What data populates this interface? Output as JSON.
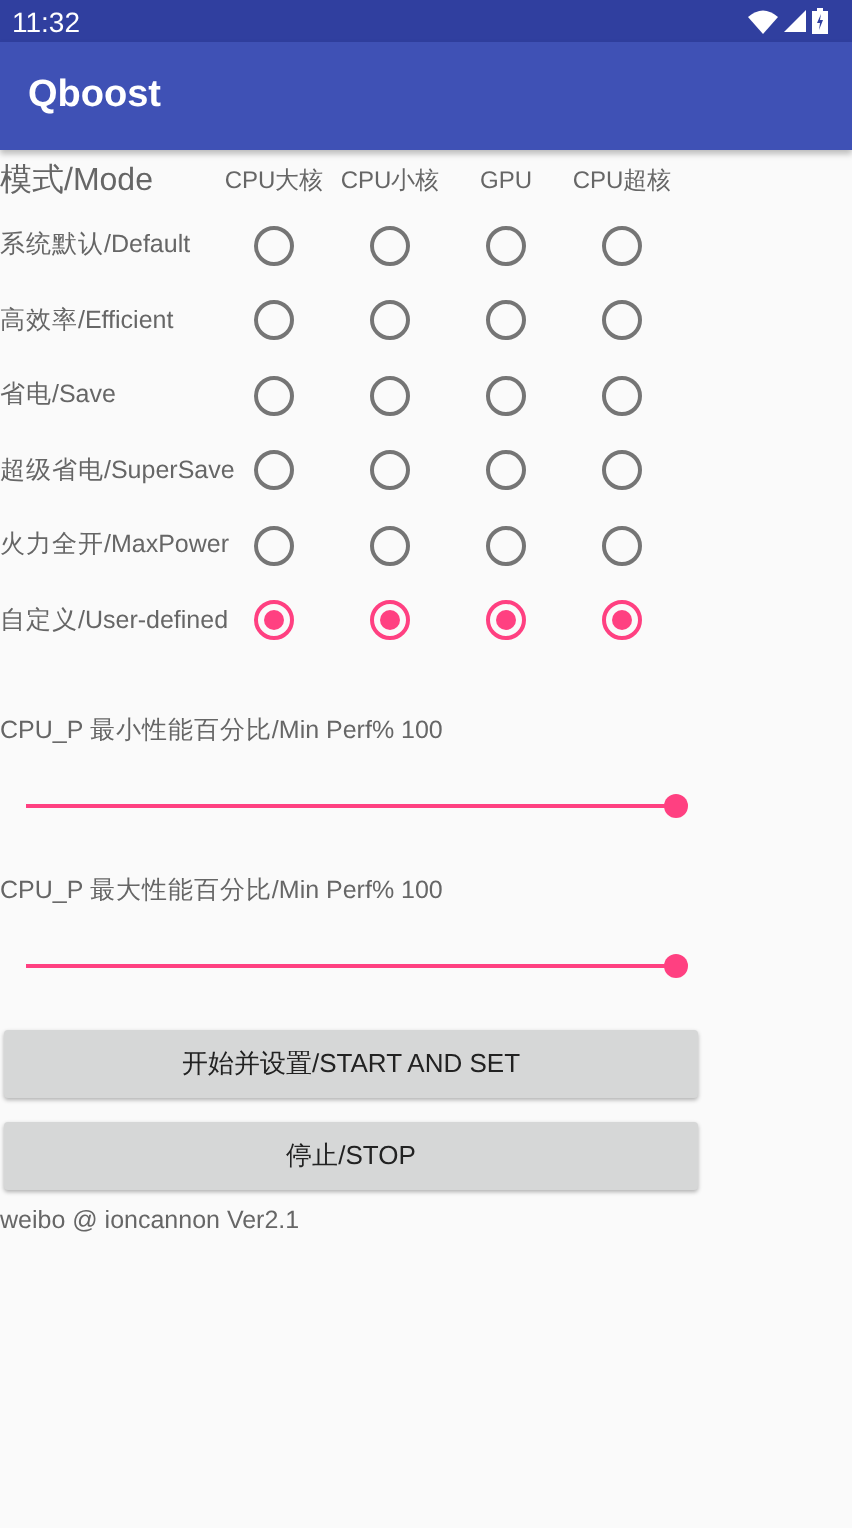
{
  "status_bar": {
    "time": "11:32"
  },
  "app_bar": {
    "title": "Qboost"
  },
  "table": {
    "header": "模式/Mode",
    "columns": [
      "CPU大核",
      "CPU小核",
      "GPU",
      "CPU超核"
    ],
    "rows": [
      {
        "label": "系统默认/Default",
        "radios": [
          {
            "selected": false
          },
          {
            "selected": false
          },
          {
            "selected": false
          },
          {
            "selected": false
          }
        ]
      },
      {
        "label": "高效率/Efficient",
        "radios": [
          {
            "selected": false
          },
          {
            "selected": false
          },
          {
            "selected": false
          },
          {
            "selected": false
          }
        ]
      },
      {
        "label": "省电/Save",
        "radios": [
          {
            "selected": false
          },
          {
            "selected": false
          },
          {
            "selected": false
          },
          {
            "selected": false
          }
        ]
      },
      {
        "label": "超级省电/SuperSave",
        "radios": [
          {
            "selected": false
          },
          {
            "selected": false
          },
          {
            "selected": false
          },
          {
            "selected": false
          }
        ]
      },
      {
        "label": "火力全开/MaxPower",
        "radios": [
          {
            "selected": false
          },
          {
            "selected": false
          },
          {
            "selected": false
          },
          {
            "selected": false
          }
        ]
      },
      {
        "label": "自定义/User-defined",
        "radios": [
          {
            "selected": true
          },
          {
            "selected": true
          },
          {
            "selected": true
          },
          {
            "selected": true
          }
        ]
      }
    ]
  },
  "sliders": [
    {
      "label": "CPU_P 最小性能百分比/Min Perf% 100",
      "level": 1
    },
    {
      "label": "CPU_P 最大性能百分比/Min Perf% 100",
      "level": 1
    }
  ],
  "buttons": [
    "开始并设置/START AND SET",
    "停止/STOP"
  ],
  "footer": "weibo @ ioncannon Ver2.1"
}
